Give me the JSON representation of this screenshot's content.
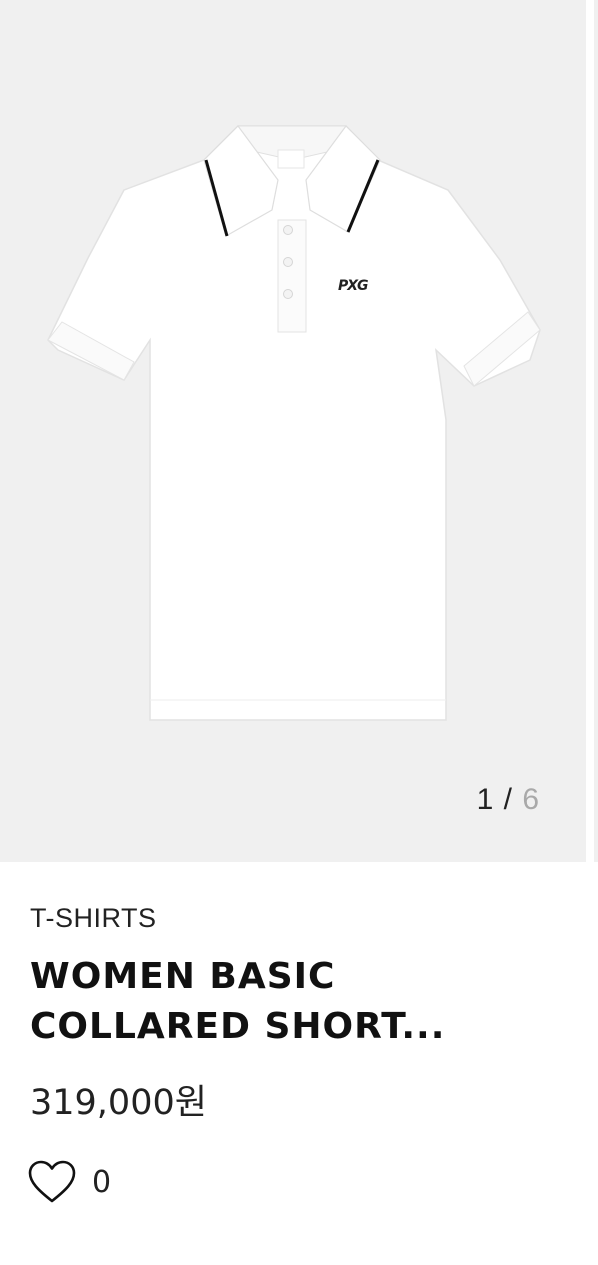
{
  "gallery": {
    "current": "1",
    "separator": "/",
    "total": "6",
    "image_icon": "polo-shirt-image",
    "logo_text": "PXG"
  },
  "product": {
    "category": "T-SHIRTS",
    "title_line1": "WOMEN BASIC",
    "title_line2": "COLLARED SHORT...",
    "price": "319,000원"
  },
  "like": {
    "icon": "heart-outline-icon",
    "count": "0"
  },
  "colors": {
    "gallery_bg": "#f0f0f0",
    "text": "#222222",
    "muted": "#a9a9a9"
  }
}
